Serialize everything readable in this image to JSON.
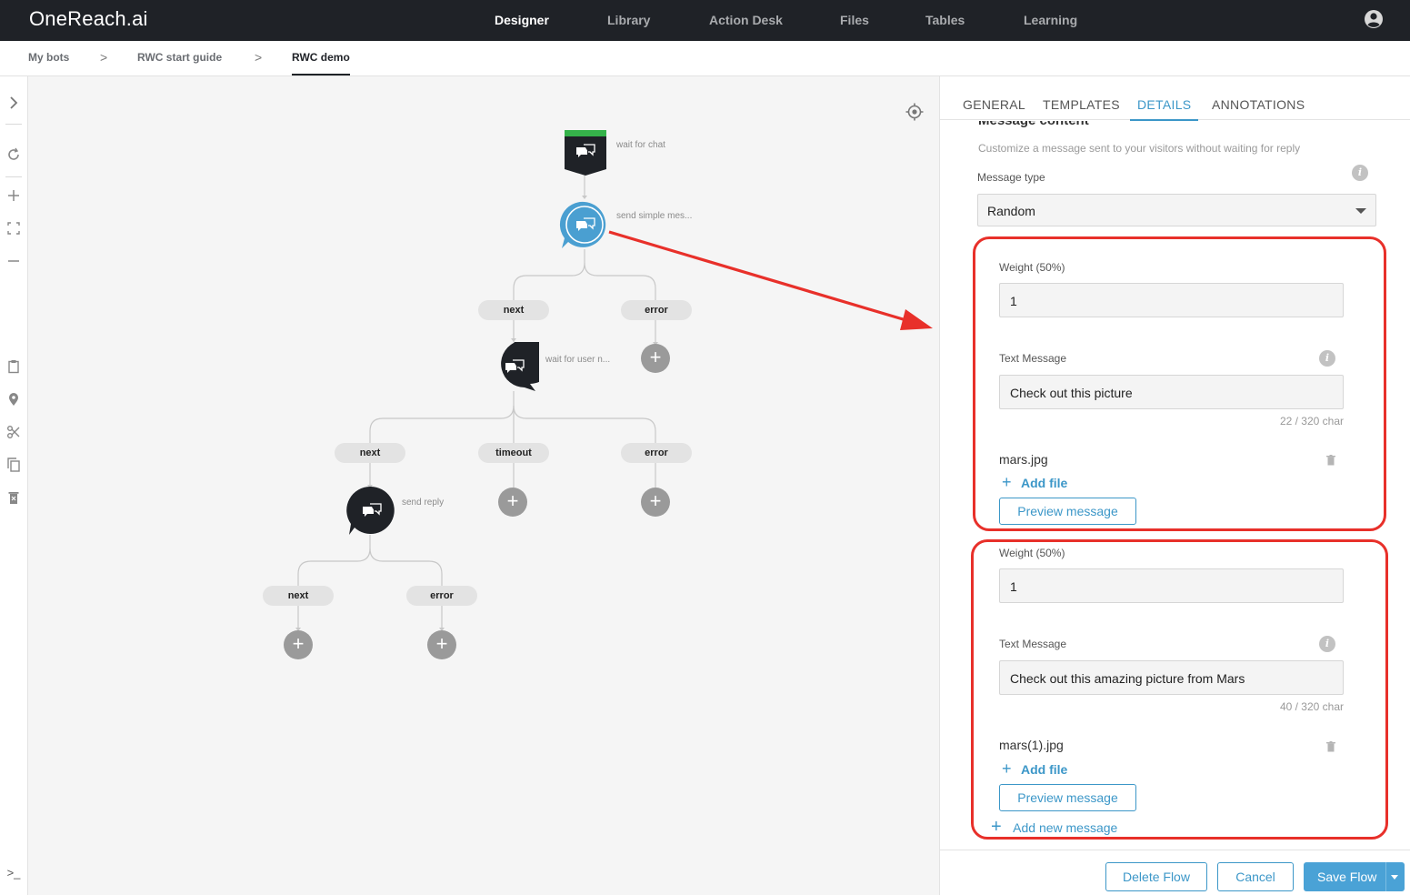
{
  "app": {
    "logo": "OneReach.ai",
    "nav": [
      "Designer",
      "Library",
      "Action Desk",
      "Files",
      "Tables",
      "Learning"
    ],
    "active_nav": "Designer"
  },
  "breadcrumb": {
    "items": [
      "My bots",
      "RWC start guide",
      "RWC demo"
    ],
    "separator": ">"
  },
  "toolbar": {
    "icons": [
      "chevron-right-icon",
      "refresh-icon",
      "zoom-in-icon",
      "fit-screen-icon",
      "zoom-out-icon",
      "clipboard-icon",
      "location-icon",
      "scissors-icon",
      "copy-icon",
      "trash-icon",
      "terminal-icon"
    ],
    "glyphs": {
      "terminal": ">_"
    }
  },
  "flow": {
    "nodes": [
      {
        "label": "wait for chat"
      },
      {
        "label": "send simple mes..."
      },
      {
        "label": "wait for user n..."
      },
      {
        "label": "send reply"
      }
    ],
    "pills": [
      "next",
      "error",
      "next",
      "timeout",
      "error",
      "next",
      "error"
    ],
    "plus_glyph": "+"
  },
  "panel": {
    "tabs": [
      "GENERAL",
      "TEMPLATES",
      "DETAILS",
      "ANNOTATIONS"
    ],
    "active_tab": "DETAILS",
    "section_title": "Message content",
    "section_help": "Customize a message sent to your visitors without waiting for reply",
    "message_type": {
      "label": "Message type",
      "value": "Random"
    },
    "info_glyph": "i",
    "messages": [
      {
        "weight_label": "Weight (50%)",
        "weight_value": "1",
        "text_label": "Text Message",
        "text_value": "Check out this picture",
        "char_count": "22 / 320 char",
        "file_name": "mars.jpg",
        "add_file": "Add file",
        "preview": "Preview message"
      },
      {
        "weight_label": "Weight (50%)",
        "weight_value": "1",
        "text_label": "Text Message",
        "text_value": "Check out this amazing picture from Mars",
        "char_count": "40 / 320 char",
        "file_name": "mars(1).jpg",
        "add_file": "Add file",
        "preview": "Preview message"
      }
    ],
    "add_plus": "+",
    "add_new_message": "Add new message",
    "footer": {
      "delete": "Delete Flow",
      "cancel": "Cancel",
      "save": "Save Flow"
    }
  },
  "colors": {
    "accent": "#3c97c8",
    "highlight": "#e8302a",
    "topbar": "#1f2227"
  }
}
